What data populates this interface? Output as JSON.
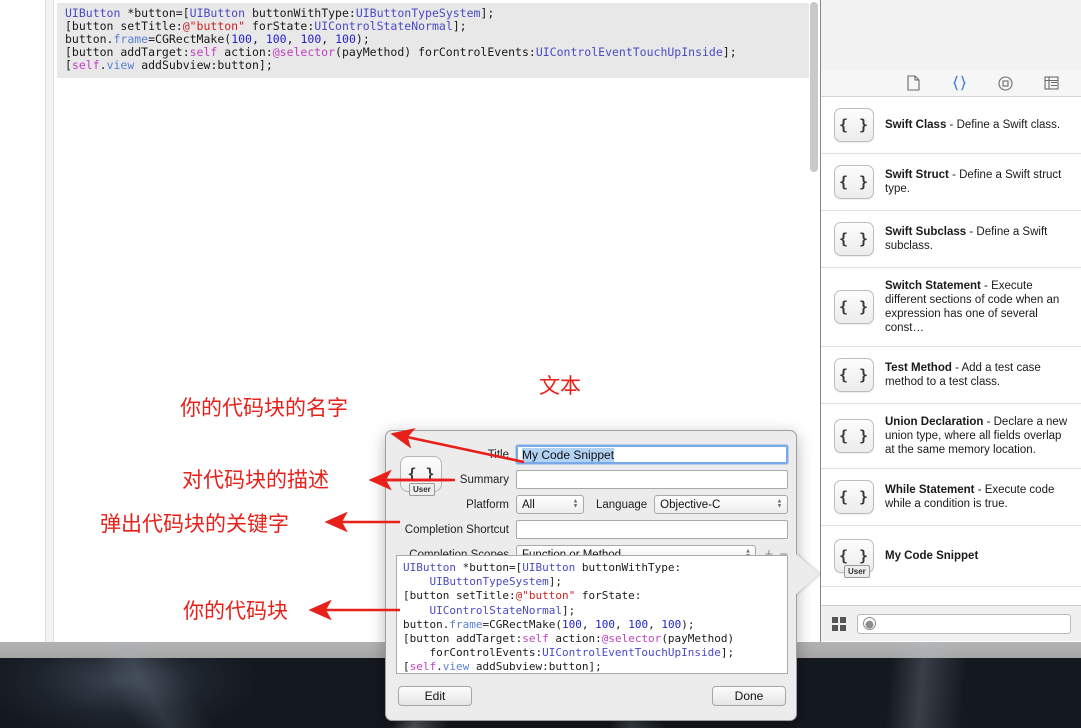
{
  "editor": {
    "code_lines": [
      "UIButton *button=[UIButton buttonWithType:UIButtonTypeSystem];",
      "[button setTitle:@\"button\" forState:UIControlStateNormal];",
      "button.frame=CGRectMake(100, 100, 100, 100);",
      "[button addTarget:self action:@selector(payMethod) forControlEvents:UIControlEventTouchUpInside];",
      "[self.view addSubview:button];"
    ]
  },
  "library": {
    "tabs": [
      {
        "name": "file-template-tab",
        "icon": "file-icon",
        "active": false
      },
      {
        "name": "code-snippet-tab",
        "icon": "braces-icon",
        "active": true
      },
      {
        "name": "media-tab",
        "icon": "disc-icon",
        "active": false
      },
      {
        "name": "object-tab",
        "icon": "list-icon",
        "active": false
      }
    ],
    "items": [
      {
        "title": "Swift Class",
        "desc": " - Define a Swift class.",
        "user": false
      },
      {
        "title": "Swift Struct",
        "desc": " - Define a Swift struct type.",
        "user": false
      },
      {
        "title": "Swift Subclass",
        "desc": " - Define a Swift subclass.",
        "user": false
      },
      {
        "title": "Switch Statement",
        "desc": " - Execute different sections of code when an expression has one of several const…",
        "user": false
      },
      {
        "title": "Test Method",
        "desc": " - Add a test case method to a test class.",
        "user": false
      },
      {
        "title": "Union Declaration",
        "desc": " - Declare a new union type, where all fields overlap at the same memory location.",
        "user": false
      },
      {
        "title": "While Statement",
        "desc": " - Execute code while a condition is true.",
        "user": false
      },
      {
        "title": "My Code Snippet",
        "desc": "",
        "user": true
      }
    ],
    "snippet_glyph": "{ }",
    "user_badge": "User",
    "search_placeholder": ""
  },
  "popover": {
    "snippet_glyph": "{ }",
    "user_badge": "User",
    "fields": {
      "title_label": "Title",
      "title_value": "My Code Snippet",
      "summary_label": "Summary",
      "summary_value": "",
      "platform_label": "Platform",
      "platform_value": "All",
      "language_label": "Language",
      "language_value": "Objective-C",
      "shortcut_label": "Completion Shortcut",
      "shortcut_value": "",
      "scopes_label": "Completion Scopes",
      "scopes_value": "Function or Method",
      "add_scope": "+",
      "remove_scope": "−"
    },
    "code_lines": [
      "UIButton *button=[UIButton buttonWithType:",
      "    UIButtonTypeSystem];",
      "[button setTitle:@\"button\" forState:",
      "    UIControlStateNormal];",
      "button.frame=CGRectMake(100, 100, 100, 100);",
      "[button addTarget:self action:@selector(payMethod)",
      "    forControlEvents:UIControlEventTouchUpInside];",
      "[self.view addSubview:button];"
    ],
    "edit_button": "Edit",
    "done_button": "Done"
  },
  "annotations": {
    "text_label": "文本",
    "name_label": "你的代码块的名字",
    "desc_label": "对代码块的描述",
    "keyword_label": "弹出代码块的关键字",
    "code_label": "你的代码块",
    "color": "#e8201a"
  }
}
